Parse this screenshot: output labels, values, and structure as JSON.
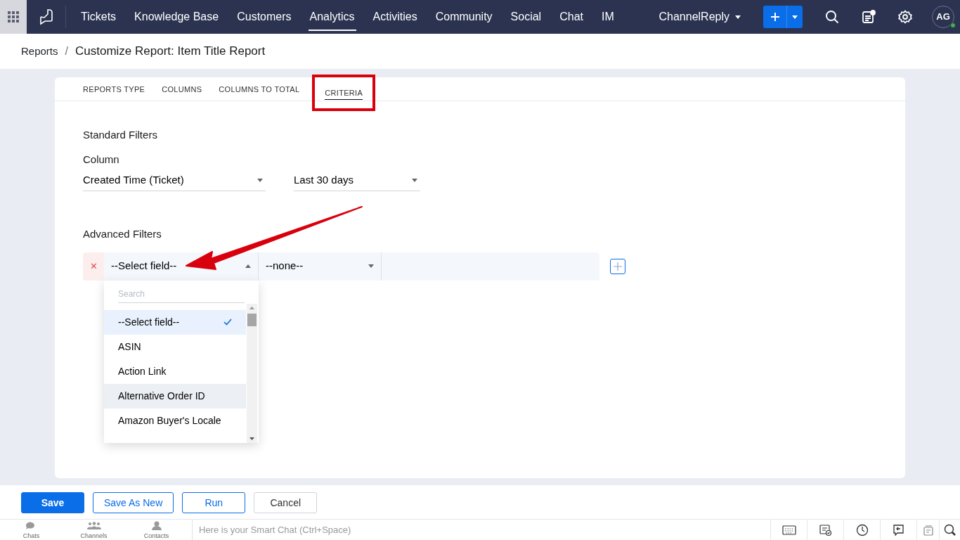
{
  "nav": {
    "tabs": [
      {
        "label": "Tickets",
        "selected": false
      },
      {
        "label": "Knowledge Base",
        "selected": false
      },
      {
        "label": "Customers",
        "selected": false
      },
      {
        "label": "Analytics",
        "selected": true
      },
      {
        "label": "Activities",
        "selected": false
      },
      {
        "label": "Community",
        "selected": false
      },
      {
        "label": "Social",
        "selected": false
      },
      {
        "label": "Chat",
        "selected": false
      },
      {
        "label": "IM",
        "selected": false
      }
    ],
    "portal": "ChannelReply",
    "avatar": "AG",
    "online": true
  },
  "breadcrumb": {
    "parent": "Reports",
    "separator": "/",
    "current": "Customize Report: Item Title Report"
  },
  "report_tabs": [
    {
      "label": "REPORTS TYPE",
      "selected": false,
      "highlighted": false
    },
    {
      "label": "COLUMNS",
      "selected": false,
      "highlighted": false
    },
    {
      "label": "COLUMNS TO TOTAL",
      "selected": false,
      "highlighted": false
    },
    {
      "label": "CRITERIA",
      "selected": true,
      "highlighted": true
    }
  ],
  "standard_filters": {
    "title": "Standard Filters",
    "column_label": "Column",
    "column_value": "Created Time (Ticket)",
    "period_value": "Last 30 days"
  },
  "advanced_filters": {
    "title": "Advanced Filters",
    "remove_symbol": "✕",
    "field_value": "--Select field--",
    "operator_value": "--none--",
    "annotated": true,
    "dropdown": {
      "placeholder": "Search",
      "options": [
        {
          "label": "--Select field--",
          "selected": true,
          "hovered": false
        },
        {
          "label": "ASIN",
          "selected": false,
          "hovered": false
        },
        {
          "label": "Action Link",
          "selected": false,
          "hovered": false
        },
        {
          "label": "Alternative Order ID",
          "selected": false,
          "hovered": true
        },
        {
          "label": "Amazon Buyer's Locale",
          "selected": false,
          "hovered": false
        }
      ]
    }
  },
  "buttons": [
    {
      "label": "Save",
      "kind": "primary"
    },
    {
      "label": "Save As New",
      "kind": "outline"
    },
    {
      "label": "Run",
      "kind": "outline"
    },
    {
      "label": "Cancel",
      "kind": "secondary"
    }
  ],
  "chat_bar": {
    "tabs": [
      {
        "label": "Chats",
        "kind": "chats"
      },
      {
        "label": "Channels",
        "kind": "channels"
      },
      {
        "label": "Contacts",
        "kind": "contacts"
      }
    ],
    "placeholder": "Here is your Smart Chat (Ctrl+Space)"
  }
}
